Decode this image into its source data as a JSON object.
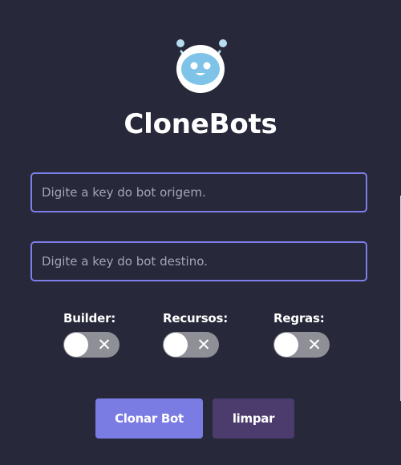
{
  "app": {
    "title": "CloneBots",
    "logo_icon": "robot-icon"
  },
  "form": {
    "origin_placeholder": "Digite a key do bot origem.",
    "origin_value": "",
    "dest_placeholder": "Digite a key do bot destino.",
    "dest_value": ""
  },
  "toggles": [
    {
      "label": "Builder:",
      "enabled": false,
      "icon": "x-icon"
    },
    {
      "label": "Recursos:",
      "enabled": false,
      "icon": "x-icon"
    },
    {
      "label": "Regras:",
      "enabled": false,
      "icon": "x-icon"
    }
  ],
  "actions": {
    "clone_label": "Clonar Bot",
    "clear_label": "limpar"
  },
  "colors": {
    "background": "#272839",
    "accent": "#7a7be3",
    "secondary_button": "#4c3c6d",
    "toggle_off": "#8e8f97",
    "input_border": "#7d7ee8"
  }
}
